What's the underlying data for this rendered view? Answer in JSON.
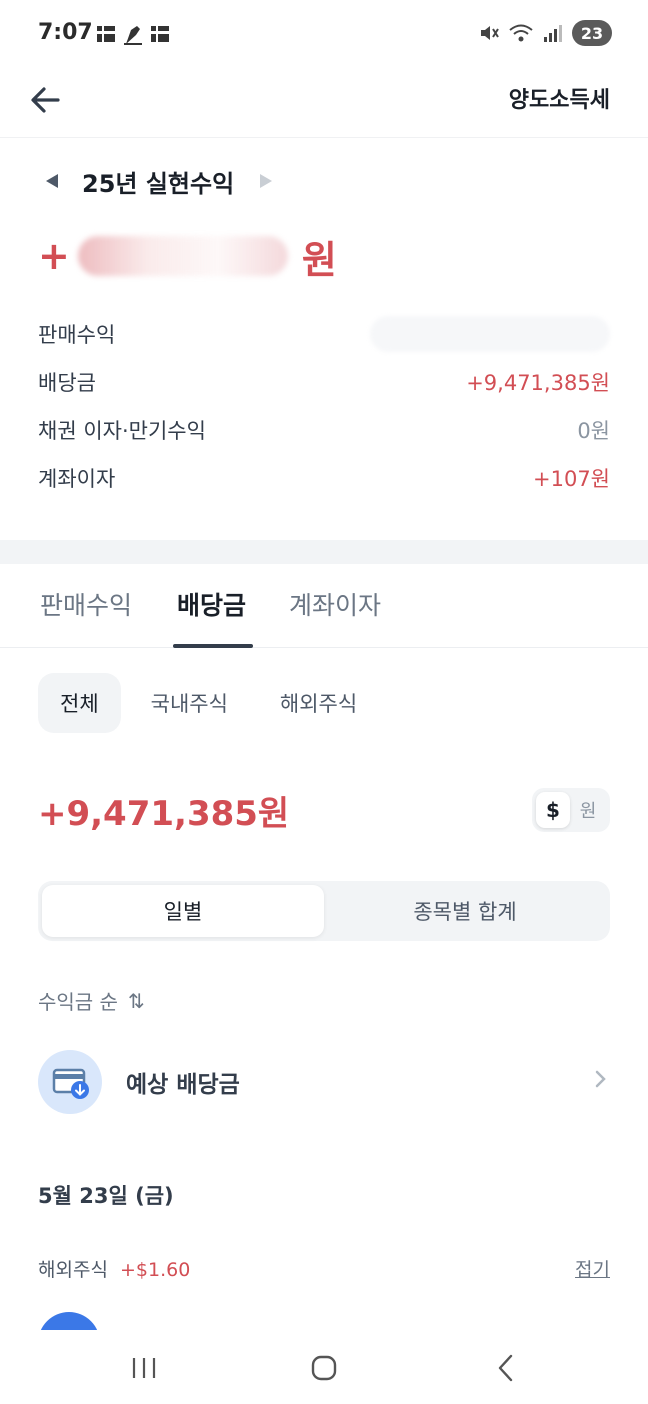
{
  "status_bar": {
    "time": "7:07",
    "battery": "23",
    "icons": [
      "notification-icon",
      "pen-icon",
      "notification-icon",
      "mute-icon",
      "wifi-icon",
      "signal-icon"
    ]
  },
  "header": {
    "back_icon": "arrow-left-icon",
    "right_link": "양도소득세"
  },
  "year_selector": {
    "label": "25년 실현수익"
  },
  "realized": {
    "sign": "+",
    "unit": "원"
  },
  "summary": {
    "rows": [
      {
        "label": "판매수익",
        "value": ""
      },
      {
        "label": "배당금",
        "value": "+9,471,385원"
      },
      {
        "label": "채권 이자·만기수익",
        "value": "0원"
      },
      {
        "label": "계좌이자",
        "value": "+107원"
      }
    ]
  },
  "main_tabs": [
    {
      "label": "판매수익",
      "active": false
    },
    {
      "label": "배당금",
      "active": true
    },
    {
      "label": "계좌이자",
      "active": false
    }
  ],
  "filter_chips": [
    {
      "label": "전체",
      "active": true
    },
    {
      "label": "국내주식",
      "active": false
    },
    {
      "label": "해외주식",
      "active": false
    }
  ],
  "total": {
    "amount": "+9,471,385원",
    "currency_dollar": "$",
    "currency_won": "원"
  },
  "segment": {
    "options": [
      "일별",
      "종목별 합계"
    ],
    "selected": "일별"
  },
  "sort": {
    "label": "수익금 순",
    "icon": "sort-arrows-icon",
    "glyph": "⇅"
  },
  "expected_dividend": {
    "label": "예상 배당금"
  },
  "date_group": {
    "date": "5월 23일 (금)",
    "market": "해외주식",
    "amount": "+$1.60",
    "collapse": "접기"
  },
  "colors": {
    "accent_red": "#d24e54",
    "text_dark": "#191f28",
    "bg_gray": "#f2f4f6",
    "icon_blue": "#3b78e7"
  }
}
